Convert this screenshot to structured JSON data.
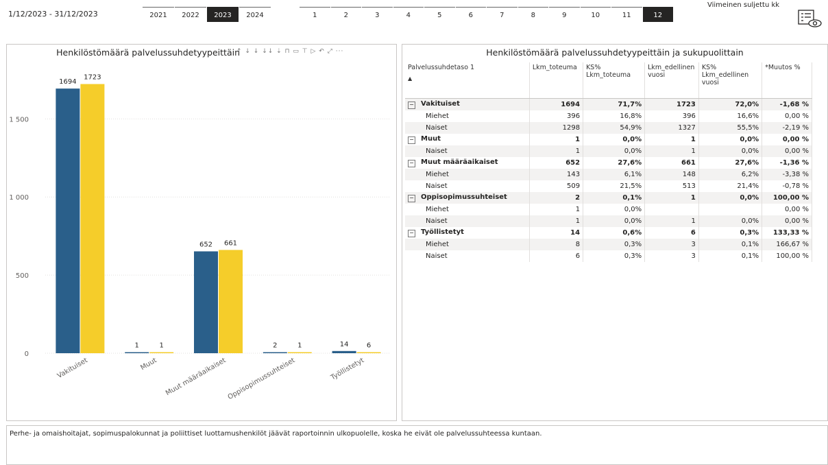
{
  "header": {
    "date_range": "1/12/2023 - 31/12/2023",
    "years": [
      {
        "label": "2021",
        "selected": false
      },
      {
        "label": "2022",
        "selected": false
      },
      {
        "label": "2023",
        "selected": true
      },
      {
        "label": "2024",
        "selected": false
      }
    ],
    "months": [
      {
        "label": "1",
        "selected": false
      },
      {
        "label": "2",
        "selected": false
      },
      {
        "label": "3",
        "selected": false
      },
      {
        "label": "4",
        "selected": false
      },
      {
        "label": "5",
        "selected": false
      },
      {
        "label": "6",
        "selected": false
      },
      {
        "label": "7",
        "selected": false
      },
      {
        "label": "8",
        "selected": false
      },
      {
        "label": "9",
        "selected": false
      },
      {
        "label": "10",
        "selected": false
      },
      {
        "label": "11",
        "selected": false
      },
      {
        "label": "12",
        "selected": true
      }
    ],
    "last_closed_label": "Viimeinen suljettu kk",
    "report_icon": "report-view-icon"
  },
  "chart": {
    "title": "Henkilöstömäärä palvelussuhdetyypeittäin",
    "toolbar_glyphs": "↑ ↓ ↓ ↓↓ ⇣ ⊓ ▭ ⊤ ▷ ↶ ⤢ ···"
  },
  "chart_data": {
    "type": "bar",
    "categories": [
      "Vakituiset",
      "Muut",
      "Muut määräaikaiset",
      "Oppisopimussuhteiset",
      "Työllistetyt"
    ],
    "series": [
      {
        "values": [
          1694,
          1,
          652,
          2,
          14
        ],
        "color": "#2a5f8a"
      },
      {
        "values": [
          1723,
          1,
          661,
          1,
          6
        ],
        "color": "#f5cd2a"
      }
    ],
    "yticks": [
      0,
      500,
      1000,
      1500
    ],
    "ytick_labels": [
      "0",
      "500",
      "1 000",
      "1 500"
    ],
    "ylim": [
      0,
      1800
    ],
    "grid": true
  },
  "table": {
    "title": "Henkilöstömäärä palvelussuhdetyypeittäin ja sukupuolittain",
    "columns": [
      "Palvelussuhdetaso 1",
      "Lkm_toteuma",
      "KS% Lkm_toteuma",
      "Lkm_edellinen vuosi",
      "KS% Lkm_edellinen vuosi",
      "*Muutos %"
    ],
    "sort_indicator": "▲",
    "rows": [
      {
        "level": 1,
        "label": "Vakituiset",
        "cells": [
          "1694",
          "71,7%",
          "1723",
          "72,0%",
          "-1,68 %"
        ]
      },
      {
        "level": 2,
        "label": "Miehet",
        "cells": [
          "396",
          "16,8%",
          "396",
          "16,6%",
          "0,00 %"
        ]
      },
      {
        "level": 2,
        "label": "Naiset",
        "cells": [
          "1298",
          "54,9%",
          "1327",
          "55,5%",
          "-2,19 %"
        ]
      },
      {
        "level": 1,
        "label": "Muut",
        "cells": [
          "1",
          "0,0%",
          "1",
          "0,0%",
          "0,00 %"
        ]
      },
      {
        "level": 2,
        "label": "Naiset",
        "cells": [
          "1",
          "0,0%",
          "1",
          "0,0%",
          "0,00 %"
        ]
      },
      {
        "level": 1,
        "label": "Muut määräaikaiset",
        "cells": [
          "652",
          "27,6%",
          "661",
          "27,6%",
          "-1,36 %"
        ]
      },
      {
        "level": 2,
        "label": "Miehet",
        "cells": [
          "143",
          "6,1%",
          "148",
          "6,2%",
          "-3,38 %"
        ]
      },
      {
        "level": 2,
        "label": "Naiset",
        "cells": [
          "509",
          "21,5%",
          "513",
          "21,4%",
          "-0,78 %"
        ]
      },
      {
        "level": 1,
        "label": "Oppisopimussuhteiset",
        "cells": [
          "2",
          "0,1%",
          "1",
          "0,0%",
          "100,00 %"
        ]
      },
      {
        "level": 2,
        "label": "Miehet",
        "cells": [
          "1",
          "0,0%",
          "",
          "",
          "0,00 %"
        ]
      },
      {
        "level": 2,
        "label": "Naiset",
        "cells": [
          "1",
          "0,0%",
          "1",
          "0,0%",
          "0,00 %"
        ]
      },
      {
        "level": 1,
        "label": "Työllistetyt",
        "cells": [
          "14",
          "0,6%",
          "6",
          "0,3%",
          "133,33 %"
        ]
      },
      {
        "level": 2,
        "label": "Miehet",
        "cells": [
          "8",
          "0,3%",
          "3",
          "0,1%",
          "166,67 %"
        ]
      },
      {
        "level": 2,
        "label": "Naiset",
        "cells": [
          "6",
          "0,3%",
          "3",
          "0,1%",
          "100,00 %"
        ]
      }
    ],
    "expander_glyph": "⊟"
  },
  "note": {
    "text": "Perhe- ja omaishoitajat, sopimuspalokunnat ja poliittiset luottamushenkilöt jäävät raportoinnin ulkopuolelle, koska he eivät ole palvelussuhteessa kuntaan."
  }
}
